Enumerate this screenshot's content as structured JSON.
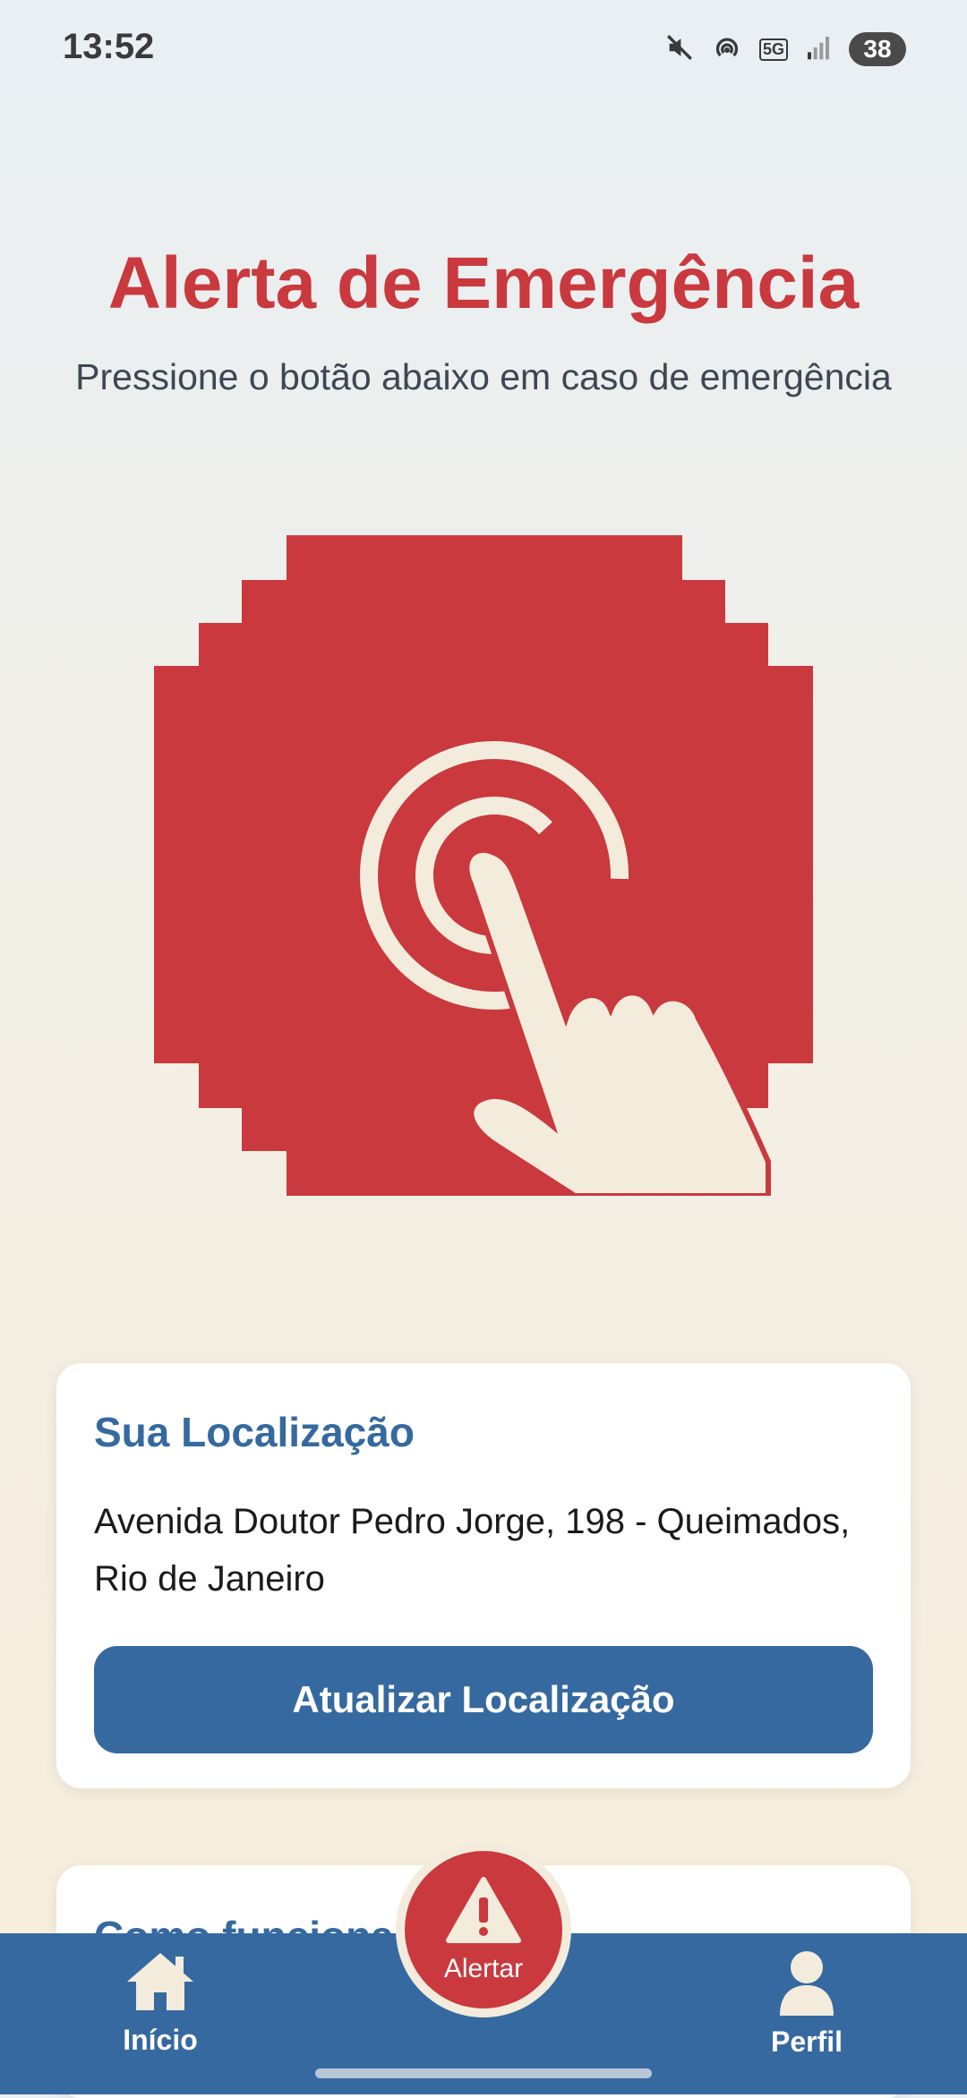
{
  "status_bar": {
    "time": "13:52",
    "battery": "38",
    "network": "5G"
  },
  "header": {
    "title": "Alerta de Emergência",
    "subtitle": "Pressione o botão abaixo em caso de emergência"
  },
  "location_card": {
    "title": "Sua Localização",
    "address": "Avenida Doutor Pedro Jorge, 198 - Queimados, Rio de Janeiro",
    "update_button": "Atualizar Localização"
  },
  "how_card": {
    "title": "Como funciona"
  },
  "bottom_nav": {
    "home_label": "Início",
    "alert_label": "Alertar",
    "profile_label": "Perfil"
  },
  "colors": {
    "accent_red": "#c9393e",
    "accent_blue": "#36699f",
    "cream": "#f3ecdc"
  }
}
